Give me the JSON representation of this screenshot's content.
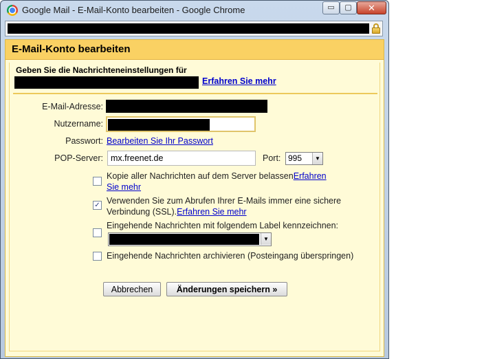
{
  "window": {
    "title": "Google Mail - E-Mail-Konto bearbeiten - Google Chrome",
    "minimize_glyph": "▭",
    "maximize_glyph": "▢",
    "close_glyph": "✕"
  },
  "dialog": {
    "header": "E-Mail-Konto bearbeiten",
    "intro": "Geben Sie die Nachrichteneinstellungen für",
    "learn_more": "Erfahren Sie mehr"
  },
  "form": {
    "email_label": "E-Mail-Adresse:",
    "username_label": "Nutzername:",
    "password_label": "Passwort:",
    "password_link": "Bearbeiten Sie Ihr Passwort",
    "pop_label": "POP-Server:",
    "pop_value": "mx.freenet.de",
    "port_label": "Port:",
    "port_value": "995"
  },
  "options": [
    {
      "text": "Kopie aller Nachrichten auf dem Server belassen",
      "link_a": "Erfahren",
      "link_b": "Sie mehr",
      "checked": false
    },
    {
      "text_line1": "Verwenden Sie zum Abrufen Ihrer E-Mails immer eine sichere",
      "text_line2": "Verbindung (SSL).",
      "link": "Erfahren Sie mehr",
      "checked": true
    },
    {
      "text": "Eingehende Nachrichten mit folgendem Label kennzeichnen:",
      "checked": false
    },
    {
      "text": "Eingehende Nachrichten archivieren (Posteingang überspringen)",
      "checked": false
    }
  ],
  "buttons": {
    "cancel": "Abbrechen",
    "save": "Änderungen speichern »"
  },
  "icons": {
    "checkmark": "✓",
    "dropdown_arrow": "▼"
  }
}
